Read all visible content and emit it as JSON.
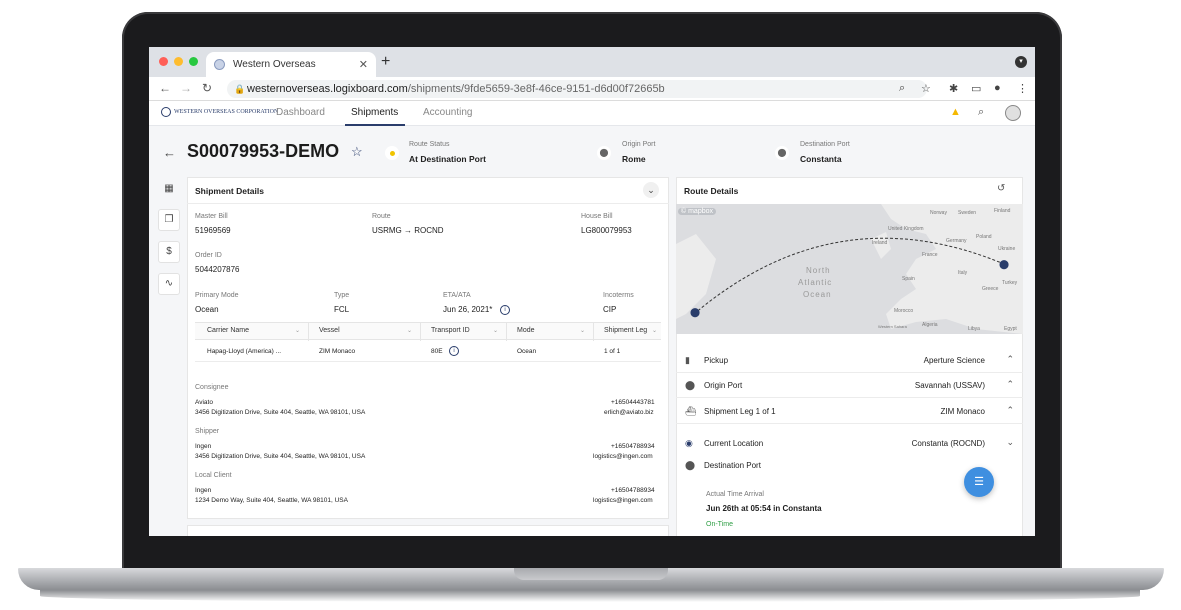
{
  "browser": {
    "tab_title": "Western Overseas",
    "url_domain": "westernoverseas.logixboard.com",
    "url_path": "/shipments/9fde5659-3e8f-46ce-9151-d6d00f72665b"
  },
  "app": {
    "logo_text": "WESTERN OVERSEAS CORPORATION",
    "nav": [
      "Dashboard",
      "Shipments",
      "Accounting"
    ]
  },
  "shipment": {
    "id": "S00079953-DEMO",
    "route_status_label": "Route Status",
    "route_status": "At Destination Port",
    "origin_label": "Origin Port",
    "origin": "Rome",
    "destination_label": "Destination Port",
    "destination": "Constanta"
  },
  "details": {
    "title": "Shipment Details",
    "master_bill_label": "Master Bill",
    "master_bill": "51969569",
    "route_label": "Route",
    "route": "USRMG → ROCND",
    "house_bill_label": "House Bill",
    "house_bill": "LG800079953",
    "order_id_label": "Order ID",
    "order_id": "5044207876",
    "primary_mode_label": "Primary Mode",
    "primary_mode": "Ocean",
    "type_label": "Type",
    "type": "FCL",
    "eta_label": "ETA/ATA",
    "eta": "Jun 26, 2021*",
    "incoterms_label": "Incoterms",
    "incoterms": "CIP",
    "table": {
      "headers": [
        "Carrier Name",
        "Vessel",
        "Transport ID",
        "Mode",
        "Shipment Leg"
      ],
      "row": [
        "Hapag-Lloyd (America) ...",
        "ZIM Monaco",
        "80E",
        "Ocean",
        "1 of 1"
      ]
    },
    "consignee_label": "Consignee",
    "consignee_name": "Aviato",
    "consignee_address": "3456 Digitization Drive, Suite 404, Seattle, WA 98101, USA",
    "consignee_phone": "+16504443781",
    "consignee_email": "erlich@aviato.biz",
    "shipper_label": "Shipper",
    "shipper_name": "Ingen",
    "shipper_address": "3456 Digitization Drive, Suite 404, Seattle, WA 98101, USA",
    "shipper_phone": "+16504788934",
    "shipper_email": "logistics@ingen.com",
    "local_client_label": "Local Client",
    "local_client_name": "Ingen",
    "local_client_address": "1234 Demo Way, Suite 404, Seattle, WA 98101, USA",
    "local_client_phone": "+16504788934",
    "local_client_email": "logistics@ingen.com"
  },
  "route_details": {
    "title": "Route Details",
    "map_attribution": "© mapbox",
    "map_labels": [
      "North",
      "Atlantic",
      "Ocean",
      "Norway",
      "Sweden",
      "Finland",
      "United Kingdom",
      "Ireland",
      "Germany",
      "Poland",
      "Ukraine",
      "France",
      "Spain",
      "Italy",
      "Greece",
      "Turkey",
      "Morocco",
      "Algeria",
      "Libya",
      "Egypt",
      "Western Sahara"
    ],
    "rows": [
      {
        "label": "Pickup",
        "value": "Aperture Science"
      },
      {
        "label": "Origin Port",
        "value": "Savannah  (USSAV)"
      },
      {
        "label": "Shipment Leg 1 of 1",
        "value": "ZIM Monaco"
      },
      {
        "label": "Current Location",
        "value": "Constanta  (ROCND)"
      },
      {
        "label": "Destination Port",
        "value": ""
      }
    ],
    "actual_arrival_label": "Actual Time Arrival",
    "actual_arrival": "Jun 26th at 05:54 in Constanta",
    "status": "On-Time"
  },
  "colors": {
    "accent": "#2a3d6b",
    "fab": "#3f8fe0",
    "status_dot": "#f0c400",
    "on_time": "#2e9e44",
    "warning": "#f5b800"
  }
}
